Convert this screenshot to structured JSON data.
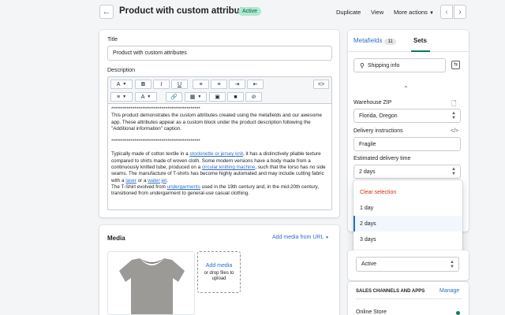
{
  "header": {
    "back_icon": "arrow-left-icon",
    "title": "Product with custom attributes",
    "status_badge": "Active",
    "actions": [
      "Duplicate",
      "View",
      "More actions"
    ]
  },
  "product": {
    "title_label": "Title",
    "title_value": "Product with custom attributes",
    "description_label": "Description",
    "stars_line": "**********************************************",
    "intro": "This product demonstrates the custom attributes created using the metafields and our awesome app. These attributes appear as a custom block under the product description following the \"Additional information\" caption.",
    "para1_a": "Typically made of cotton textile in a ",
    "link1": "stockinette or jersey knit",
    "para1_b": ", it has a distinctively pliable texture compared to shirts made of woven cloth. Some modern versions have a body made from a continuously knitted tube, produced on a ",
    "link2": "circular knitting machine",
    "para1_c": ", such that the torso has no side seams. The manufacture of T-shirts has become highly automated and may include cutting fabric with a ",
    "link3": "laser",
    "para1_d": " or a ",
    "link4": "water jet",
    "para1_e": ".",
    "para2_a": "The T-Shirt evolved from ",
    "link5": "undergarments",
    "para2_b": " used in the 19th century and, in the mid-20th century, transitioned from undergarment to general-use casual clothing."
  },
  "editor_toolbar": {
    "font_btn": "A",
    "bold": "B",
    "italic": "I",
    "underline": "U",
    "color_btn": "A",
    "code_btn": "<>"
  },
  "media": {
    "title": "Media",
    "add_from_url": "Add media from URL",
    "add_media": "Add media",
    "drop_hint": "or drop files to upload"
  },
  "metafields": {
    "tab_metafields": "Metafields",
    "tab_count": "11",
    "tab_sets": "Sets",
    "search_value": "Shipping info",
    "warehouse_label": "Warehouse ZIP",
    "warehouse_value": "Florida, Oregon",
    "delivery_label": "Delivery instructions",
    "delivery_value": "Fragile",
    "estimated_label": "Estimated delivery time",
    "estimated_value": "2 days",
    "options": [
      "Clear selection",
      "1 day",
      "2 days",
      "3 days"
    ],
    "status_value": "Active"
  },
  "sales": {
    "title": "SALES CHANNELS AND APPS",
    "manage": "Manage",
    "online_store": "Online Store"
  },
  "colors": {
    "accent": "#2c6ecb",
    "active_badge": "#aee9d1",
    "clear_selection": "#d72c0d",
    "online_dot": "#008060"
  }
}
